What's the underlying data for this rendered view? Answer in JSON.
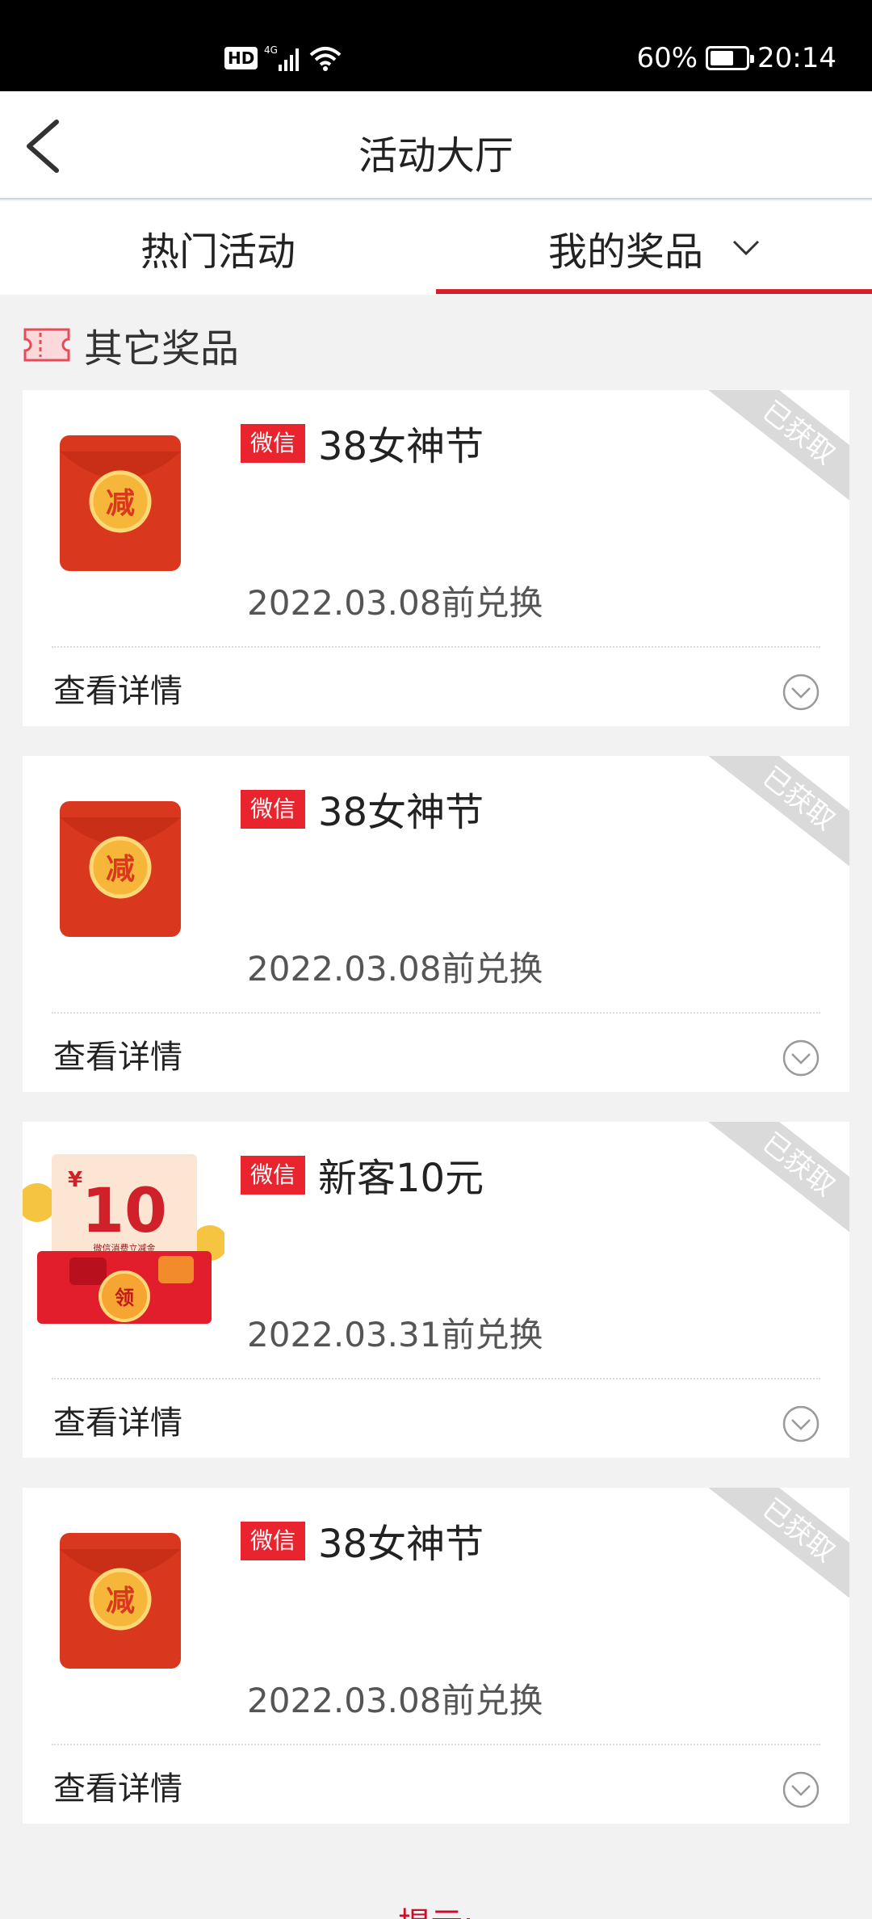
{
  "status": {
    "network": "4G",
    "battery": "60%",
    "time": "20:14"
  },
  "header": {
    "title": "活动大厅"
  },
  "tabs": [
    {
      "label": "热门活动"
    },
    {
      "label": "我的奖品"
    }
  ],
  "section": {
    "title": "其它奖品"
  },
  "cards": [
    {
      "badge": "微信",
      "title": "38女神节",
      "date": "2022.03.08前兑换",
      "detail": "查看详情",
      "ribbon": "已获取"
    },
    {
      "badge": "微信",
      "title": "38女神节",
      "date": "2022.03.08前兑换",
      "detail": "查看详情",
      "ribbon": "已获取"
    },
    {
      "badge": "微信",
      "title": "新客10元",
      "date": "2022.03.31前兑换",
      "detail": "查看详情",
      "ribbon": "已获取"
    },
    {
      "badge": "微信",
      "title": "38女神节",
      "date": "2022.03.08前兑换",
      "detail": "查看详情",
      "ribbon": "已获取"
    }
  ],
  "thumbnails": {
    "envelope_char": "减",
    "voucher_currency": "¥",
    "voucher_amount": "10",
    "voucher_caption": "微信消费立减金",
    "voucher_coin": "领"
  },
  "footer": {
    "tip": "提示:"
  },
  "colors": {
    "accent": "#d91e2b",
    "badge": "#e9242f",
    "ribbon": "#dadada"
  }
}
